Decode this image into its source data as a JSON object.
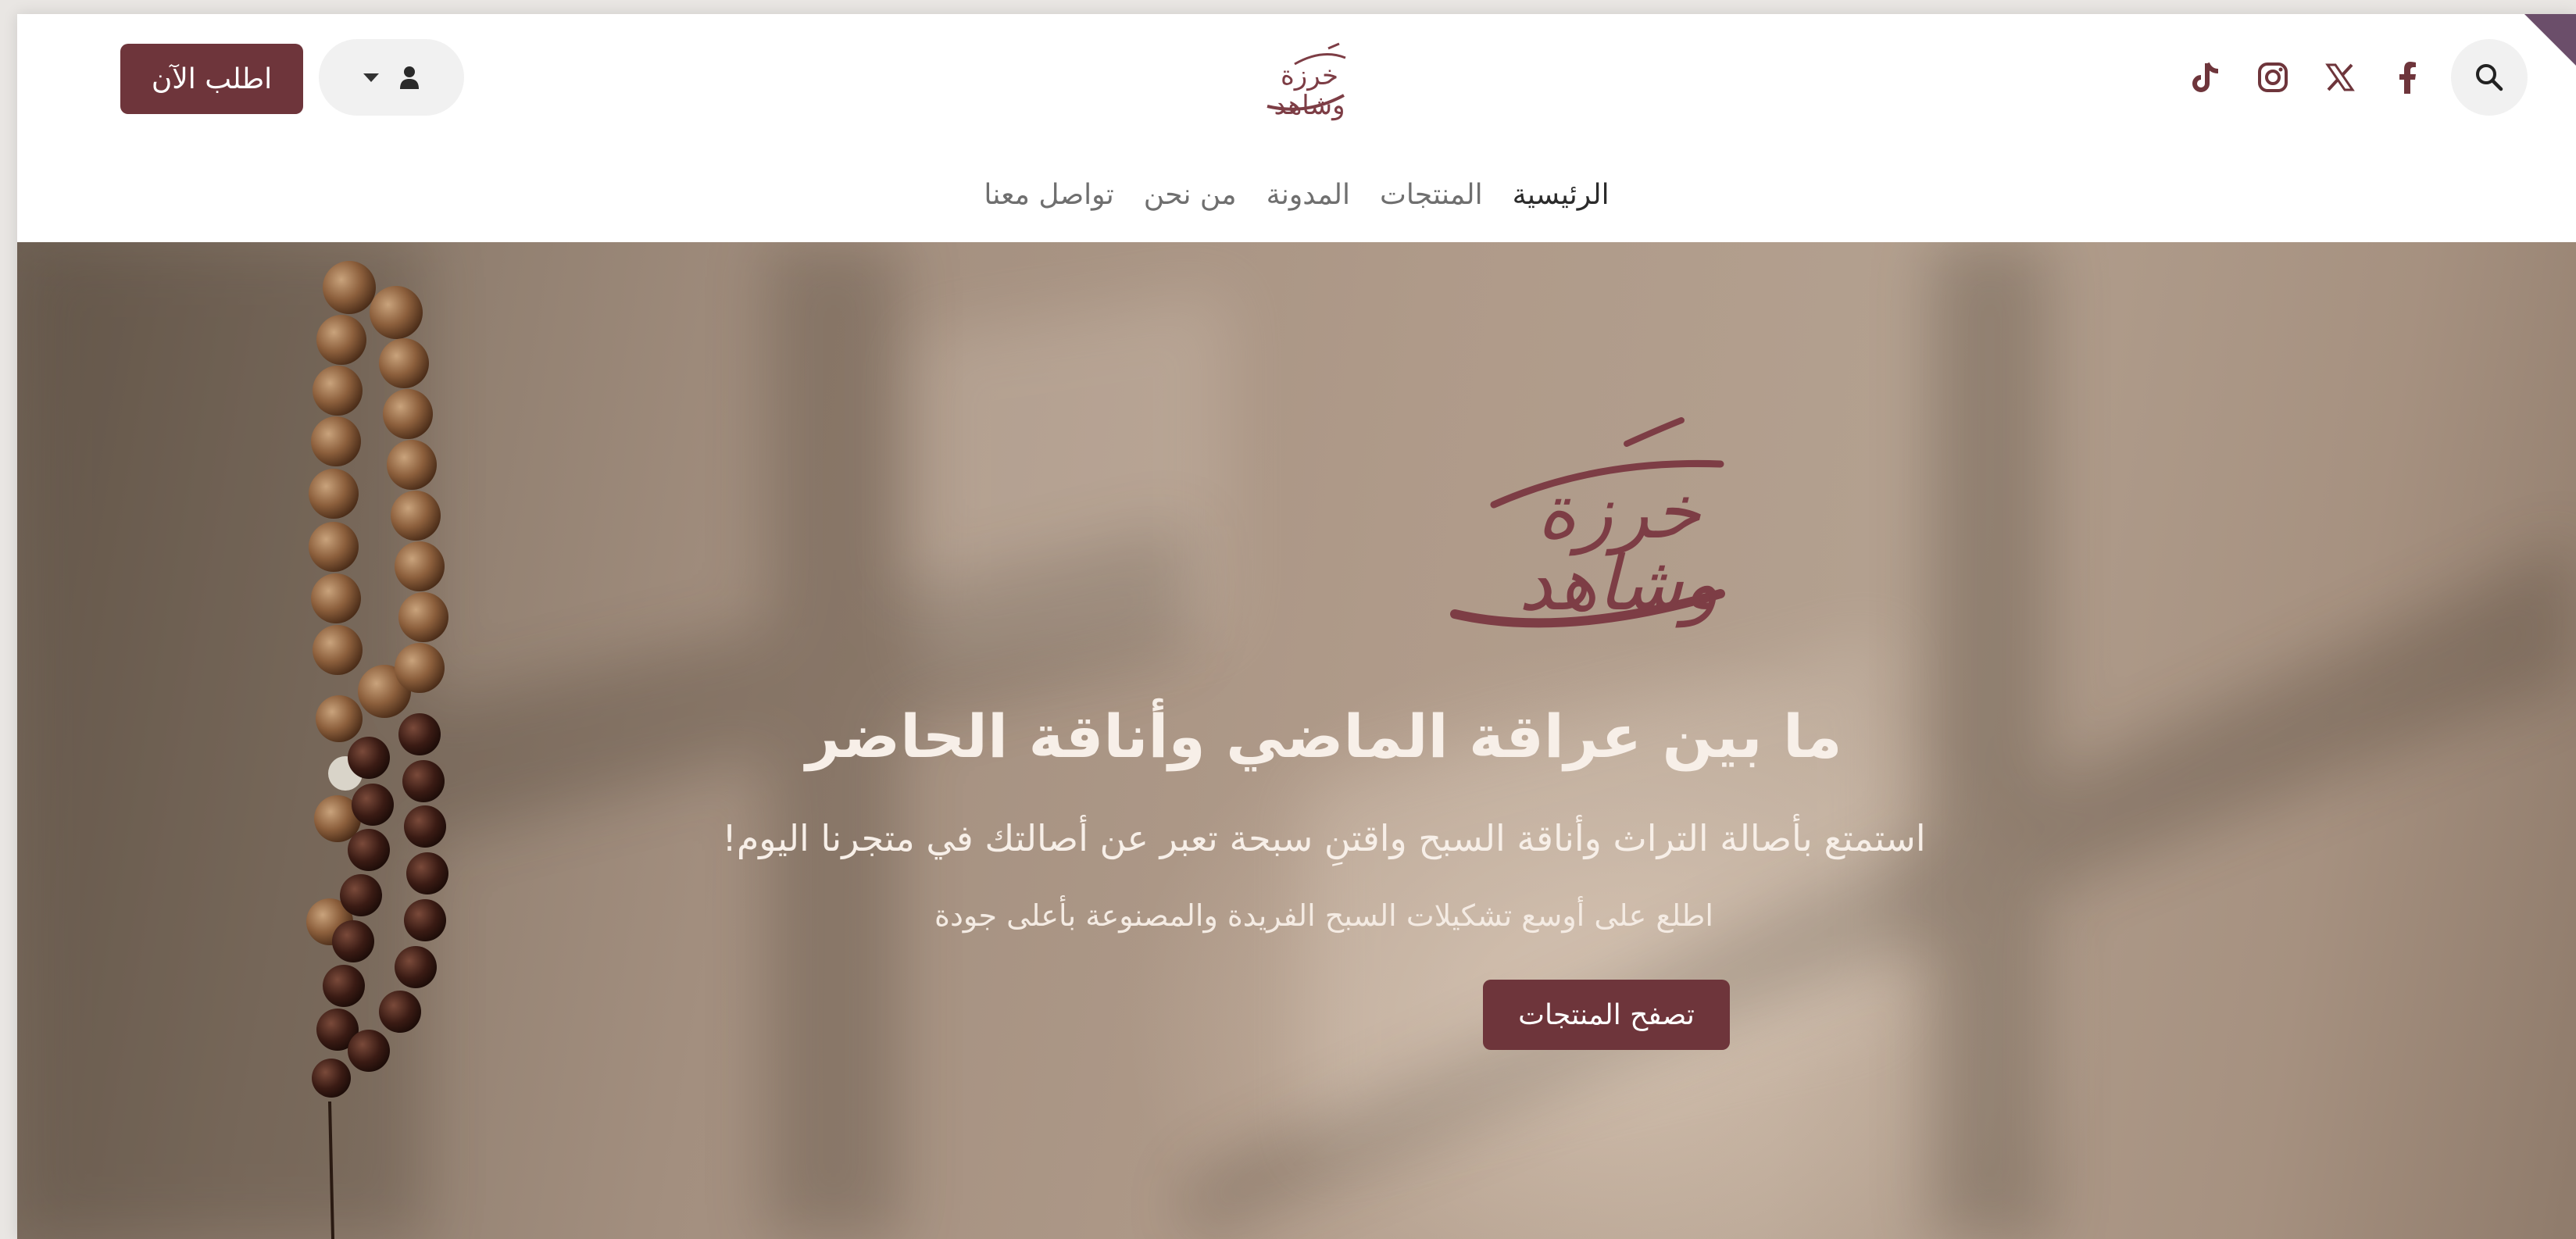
{
  "header": {
    "order_button": "اطلب الآن",
    "nav": [
      {
        "label": "الرئيسية",
        "active": true
      },
      {
        "label": "المنتجات",
        "active": false
      },
      {
        "label": "المدونة",
        "active": false
      },
      {
        "label": "من نحن",
        "active": false
      },
      {
        "label": "تواصل معنا",
        "active": false
      }
    ],
    "socials": [
      "tiktok-icon",
      "instagram-icon",
      "x-icon",
      "facebook-icon"
    ],
    "logo_text": {
      "line1": "خرزة",
      "line2": "وشاهد"
    }
  },
  "hero": {
    "title": "ما بين عراقة الماضي وأناقة الحاضر",
    "subtitle": "استمتع بأصالة التراث وأناقة السبح واقتنِ سبحة تعبر عن أصالتك في متجرنا اليوم!",
    "subtitle2": "اطلع على أوسع تشكيلات السبح الفريدة والمصنوعة بأعلى جودة",
    "cta": "تصفح المنتجات",
    "logo_text": {
      "line1": "خرزة",
      "line2": "وشاهد"
    }
  },
  "colors": {
    "brand": "#6e353b",
    "logo": "#7d3d45",
    "ribbon": "#6b4e6a",
    "nav_active": "#2b2b2b",
    "nav_inactive": "#6f6f6f"
  }
}
